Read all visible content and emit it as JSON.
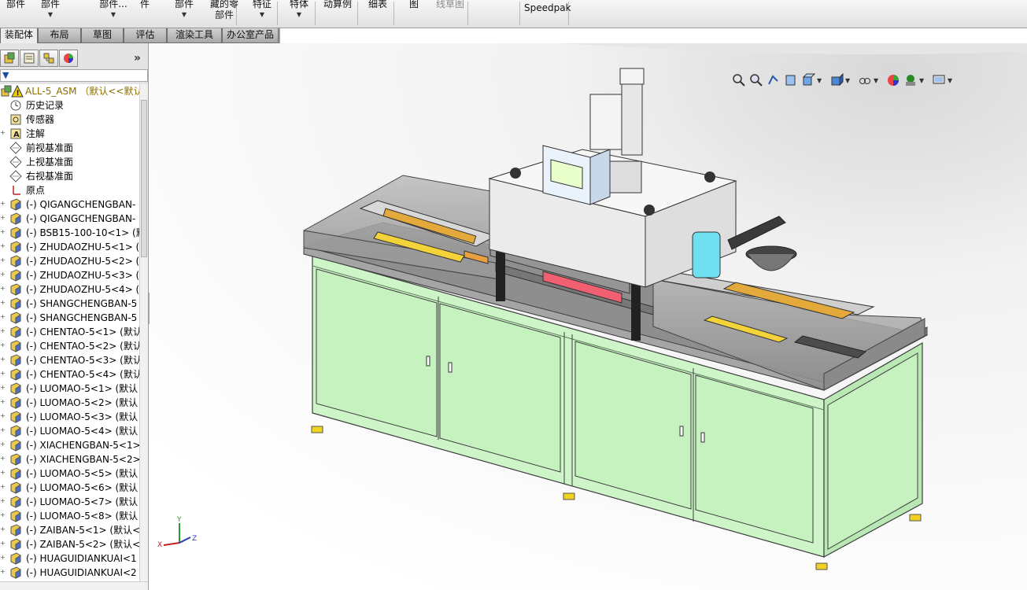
{
  "ribbon": {
    "items": [
      {
        "line1": "部件",
        "line2": "",
        "caret": false
      },
      {
        "line1": "部件",
        "line2": "",
        "caret": true
      },
      {
        "line1": "部件...",
        "line2": "",
        "caret": true
      },
      {
        "line1": "件",
        "line2": "",
        "caret": false
      },
      {
        "line1": "部件",
        "line2": "",
        "caret": true
      },
      {
        "line1": "藏的零",
        "line2": "部件",
        "caret": false
      },
      {
        "line1": "特征",
        "line2": "",
        "caret": true
      },
      {
        "line1": "特体",
        "line2": "",
        "caret": true
      },
      {
        "line1": "动算例",
        "line2": "",
        "caret": false
      },
      {
        "line1": "细表",
        "line2": "",
        "caret": false
      },
      {
        "line1": "图",
        "line2": "",
        "caret": false
      },
      {
        "line1": "线草图",
        "line2": "",
        "caret": false
      },
      {
        "line1": "Speedpak",
        "line2": "",
        "caret": false
      }
    ]
  },
  "command_tabs": [
    "装配体",
    "布局",
    "草图",
    "评估",
    "渲染工具",
    "办公室产品"
  ],
  "active_tab": "装配体",
  "feature_tree": {
    "root": "ALL-5_ASM （默认<<默认",
    "items": [
      {
        "label": "历史记录",
        "icon": "history-icon"
      },
      {
        "label": "传感器",
        "icon": "sensor-icon"
      },
      {
        "label": "注解",
        "icon": "annotation-icon"
      },
      {
        "label": "前视基准面",
        "icon": "plane-icon"
      },
      {
        "label": "上视基准面",
        "icon": "plane-icon"
      },
      {
        "label": "右视基准面",
        "icon": "plane-icon"
      },
      {
        "label": "原点",
        "icon": "origin-icon"
      },
      {
        "label": "(-) QIGANGCHENGBAN-",
        "icon": "part-icon"
      },
      {
        "label": "(-) QIGANGCHENGBAN-",
        "icon": "part-icon"
      },
      {
        "label": "(-) BSB15-100-10<1> (默",
        "icon": "part-icon"
      },
      {
        "label": "(-) ZHUDAOZHU-5<1> (",
        "icon": "part-icon"
      },
      {
        "label": "(-) ZHUDAOZHU-5<2> (",
        "icon": "part-icon"
      },
      {
        "label": "(-) ZHUDAOZHU-5<3> (",
        "icon": "part-icon"
      },
      {
        "label": "(-) ZHUDAOZHU-5<4> (",
        "icon": "part-icon"
      },
      {
        "label": "(-) SHANGCHENGBAN-5",
        "icon": "part-icon"
      },
      {
        "label": "(-) SHANGCHENGBAN-5",
        "icon": "part-icon"
      },
      {
        "label": "(-) CHENTAO-5<1> (默认",
        "icon": "part-icon"
      },
      {
        "label": "(-) CHENTAO-5<2> (默认",
        "icon": "part-icon"
      },
      {
        "label": "(-) CHENTAO-5<3> (默认",
        "icon": "part-icon"
      },
      {
        "label": "(-) CHENTAO-5<4> (默认",
        "icon": "part-icon"
      },
      {
        "label": "(-) LUOMAO-5<1> (默认",
        "icon": "part-icon"
      },
      {
        "label": "(-) LUOMAO-5<2> (默认",
        "icon": "part-icon"
      },
      {
        "label": "(-) LUOMAO-5<3> (默认",
        "icon": "part-icon"
      },
      {
        "label": "(-) LUOMAO-5<4> (默认",
        "icon": "part-icon"
      },
      {
        "label": "(-) XIACHENGBAN-5<1>",
        "icon": "part-icon"
      },
      {
        "label": "(-) XIACHENGBAN-5<2>",
        "icon": "part-icon"
      },
      {
        "label": "(-) LUOMAO-5<5> (默认",
        "icon": "part-icon"
      },
      {
        "label": "(-) LUOMAO-5<6> (默认",
        "icon": "part-icon"
      },
      {
        "label": "(-) LUOMAO-5<7> (默认",
        "icon": "part-icon"
      },
      {
        "label": "(-) LUOMAO-5<8> (默认",
        "icon": "part-icon"
      },
      {
        "label": "(-) ZAIBAN-5<1> (默认<",
        "icon": "part-icon"
      },
      {
        "label": "(-) ZAIBAN-5<2> (默认<",
        "icon": "part-icon"
      },
      {
        "label": "(-) HUAGUIDIANKUAI<1",
        "icon": "part-icon"
      },
      {
        "label": "(-) HUAGUIDIANKUAI<2",
        "icon": "part-icon"
      }
    ]
  },
  "triad": {
    "x_label": "X",
    "y_label": "Y",
    "z_label": "Z"
  },
  "colors": {
    "cabinet": "#cdf5c8",
    "frame": "#b9e8b4",
    "tabletop": "#8e8e8e",
    "accent_red": "#f06070",
    "accent_yellow": "#f3d23a",
    "accent_cyan": "#6fe0f0"
  }
}
